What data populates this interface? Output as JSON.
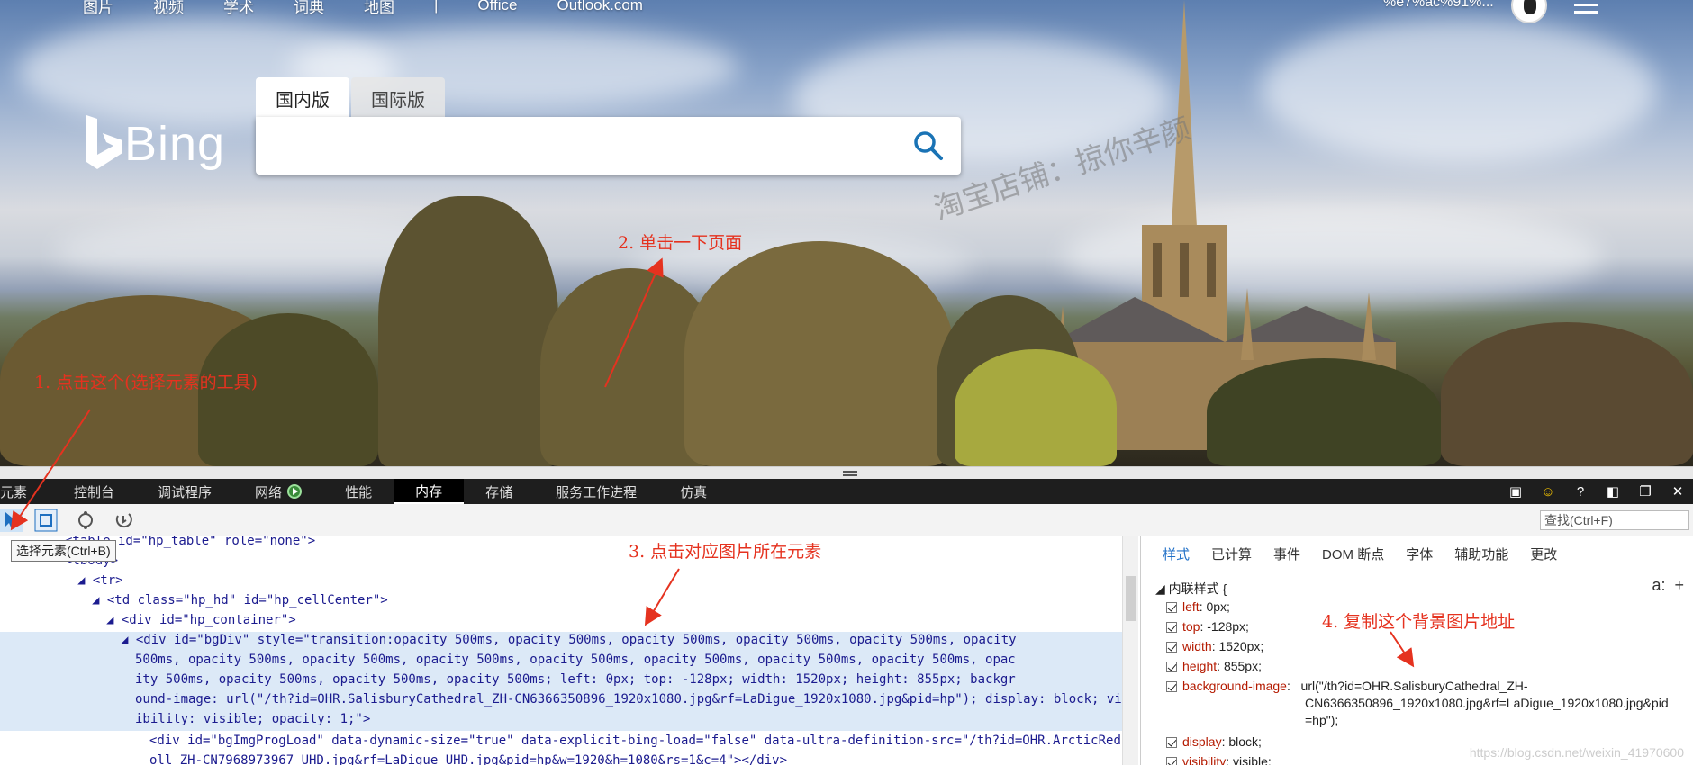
{
  "bing": {
    "nav": [
      "图片",
      "视频",
      "学术",
      "词典",
      "地图",
      "|",
      "Office",
      "Outlook.com"
    ],
    "user_id": "%e7%ac%91%...",
    "logo_text": "Bing",
    "tabs": [
      "国内版",
      "国际版"
    ],
    "search_value": "",
    "watermark": "淘宝店铺：掠你辛颜"
  },
  "annotations": {
    "a1": "1. 点击这个(选择元素的工具)",
    "a2": "2. 单击一下页面",
    "a3": "3. 点击对应图片所在元素",
    "a4": "4. 复制这个背景图片地址"
  },
  "devtools": {
    "tabs": [
      "元素",
      "控制台",
      "调试程序",
      "网络",
      "性能",
      "内存",
      "存储",
      "服务工作进程",
      "仿真"
    ],
    "selected_tab": "内存",
    "find_placeholder": "查找(Ctrl+F)",
    "tooltip": "选择元素(Ctrl+B)",
    "dom": {
      "l0": "<table id=\"hp_table\" role=\"none\">",
      "l1": "<tbody>",
      "l2": "◢ <tr>",
      "l3": "◢ <td class=\"hp_hd\" id=\"hp_cellCenter\">",
      "l4": "◢ <div id=\"hp_container\">",
      "l5": "◢ <div id=\"bgDiv\" style=\"transition:opacity 500ms, opacity 500ms, opacity 500ms, opacity 500ms, opacity 500ms, opacity",
      "l6": "500ms, opacity 500ms, opacity 500ms, opacity 500ms, opacity 500ms, opacity 500ms, opacity 500ms, opacity 500ms, opac",
      "l7": "ity 500ms, opacity 500ms, opacity 500ms, opacity 500ms; left: 0px; top: -128px; width: 1520px; height: 855px; backgr",
      "l8": "ound-image: url(\"/th?id=OHR.SalisburyCathedral_ZH-CN6366350896_1920x1080.jpg&rf=LaDigue_1920x1080.jpg&pid=hp\"); display: block; vis",
      "l9": "ibility: visible; opacity: 1;\">",
      "l10": "<div id=\"bgImgProgLoad\" data-dynamic-size=\"true\" data-explicit-bing-load=\"false\" data-ultra-definition-src=\"/th?id=OHR.ArcticRedp",
      "l11": "oll_ZH-CN7968973967_UHD.jpg&rf=LaDigue_UHD.jpg&pid=hp&w=1920&h=1080&rs=1&c=4\"></div>"
    },
    "styles_tabs": [
      "样式",
      "已计算",
      "事件",
      "DOM 断点",
      "字体",
      "辅助功能",
      "更改"
    ],
    "inline_header": "◢ 内联样式  {",
    "props": [
      {
        "name": "left",
        "value": "0px;"
      },
      {
        "name": "top",
        "value": "-128px;"
      },
      {
        "name": "width",
        "value": "1520px;"
      },
      {
        "name": "height",
        "value": "855px;"
      },
      {
        "name": "background-image",
        "value": "url(\"/th?id=OHR.SalisburyCathedral_ZH-"
      },
      {
        "name": "display",
        "value": "block;"
      },
      {
        "name": "visibility",
        "value": "visible;"
      }
    ],
    "bg_cont1": "CN6366350896_1920x1080.jpg&rf=LaDigue_1920x1080.jpg&pid",
    "bg_cont2": "=hp\");",
    "attr_btn": "a:",
    "add_btn": "+",
    "blog_mark": "https://blog.csdn.net/weixin_41970600"
  }
}
